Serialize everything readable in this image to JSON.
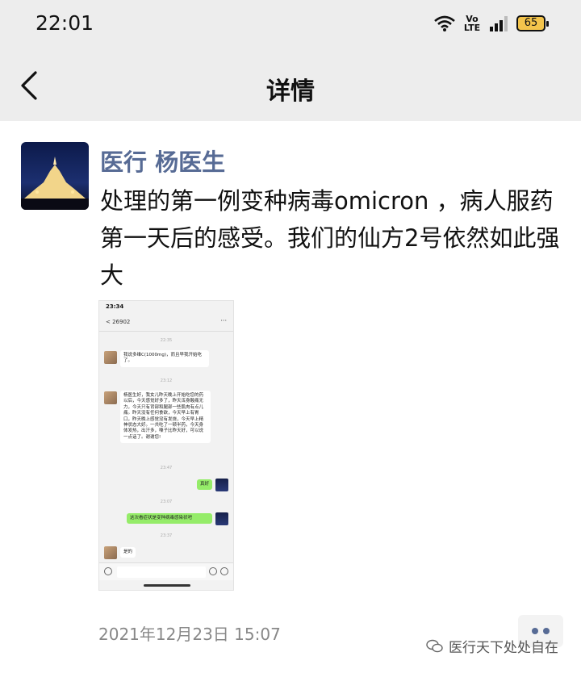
{
  "status_bar": {
    "time": "22:01",
    "volte": "Vo\nLTE",
    "battery": "65"
  },
  "nav": {
    "title": "详情"
  },
  "post": {
    "author": "医行 杨医生",
    "text": "处理的第一例变种病毒omicron ，病人服药第一天后的感受。我们的仙方2号依然如此强大",
    "date": "2021年12月23日 15:07"
  },
  "screenshot": {
    "time": "23:34",
    "back_label": "< 26902",
    "stamps": [
      "22:35",
      "23:12",
      "23:47",
      "23:07",
      "23:37"
    ],
    "messages": [
      {
        "side": "left",
        "text": "我说多维C(1000mg)，而且早我开始吃了。"
      },
      {
        "side": "left",
        "text": "杨医生好，我女儿昨天晚上开始吃您的药以后，今天感觉好多了，昨天浑身酸痛无力，今天只有背部和腿部一些肌肉有点儿痛。昨天没有任何食欲，今天早上有胃口，昨天晚上感觉没有发烧，今天早上精神状态大好。一共吃了一顿半药，今天身体发热，出汗多，嗓子比昨天好，可以说一点话了。谢谢您!"
      },
      {
        "side": "right",
        "text": "真好"
      },
      {
        "side": "right",
        "text": "这次看症状是变种病毒感染状吧"
      },
      {
        "side": "left",
        "text": "是的"
      }
    ]
  },
  "watermark": "医行天下处处自在"
}
